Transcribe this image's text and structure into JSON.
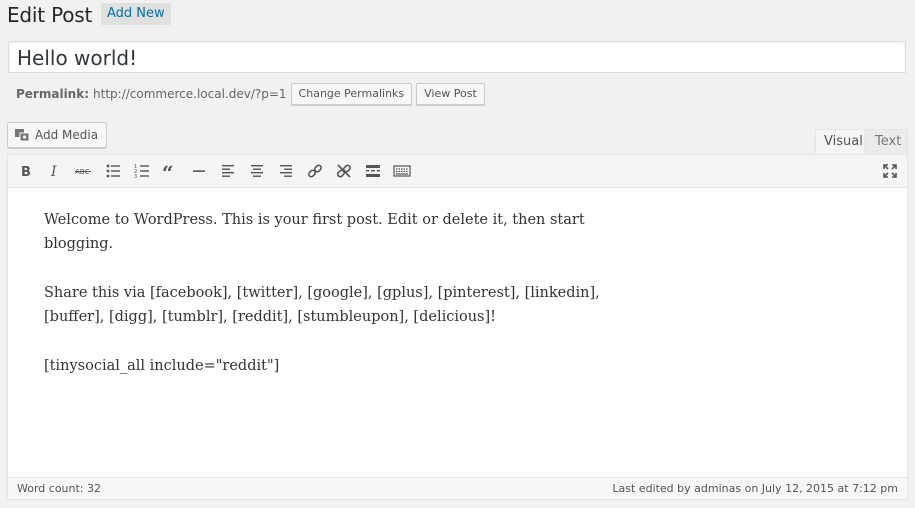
{
  "header": {
    "title": "Edit Post",
    "add_new_label": "Add New"
  },
  "post": {
    "title_value": "Hello world!"
  },
  "permalink": {
    "label": "Permalink:",
    "url": "http://commerce.local.dev/?p=1",
    "change_label": "Change Permalinks",
    "view_label": "View Post"
  },
  "media": {
    "add_media_label": "Add Media"
  },
  "tabs": {
    "visual": "Visual",
    "text": "Text"
  },
  "toolbar": {
    "icons": [
      "bold-icon",
      "italic-icon",
      "strikethrough-icon",
      "bullet-list-icon",
      "numbered-list-icon",
      "blockquote-icon",
      "horizontal-rule-icon",
      "align-left-icon",
      "align-center-icon",
      "align-right-icon",
      "link-icon",
      "unlink-icon",
      "read-more-icon",
      "toolbar-toggle-icon",
      "fullscreen-icon"
    ]
  },
  "content": {
    "p1": "Welcome to WordPress. This is your first post. Edit or delete it, then start blogging.",
    "p2": "Share this via [facebook], [twitter], [google], [gplus], [pinterest], [linkedin], [buffer], [digg], [tumblr], [reddit], [stumbleupon], [delicious]!",
    "p3": "[tinysocial_all include=\"reddit\"]"
  },
  "status": {
    "word_count": "Word count: 32",
    "last_edited": "Last edited by adminas on July 12, 2015 at 7:12 pm"
  },
  "colors": {
    "link_blue": "#0073aa",
    "background": "#f1f1f1"
  }
}
